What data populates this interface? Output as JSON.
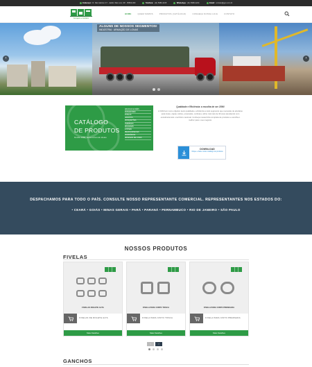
{
  "topbar": {
    "address_label": "Endereço:",
    "address": "R. São Gabriel, 47 - Jardim São Luís, SP - 05833-000",
    "phone_label": "Telefone:",
    "phone": "(11) 5980-4245",
    "whatsapp_label": "WhatsApp:",
    "whatsapp": "(11) 5980-4244",
    "email_label": "Email:",
    "email": "contato@jgm.com.br"
  },
  "brand": {
    "logo_text": "JGM",
    "tagline": "Ferragens e Artefatos"
  },
  "nav": {
    "items": [
      "HOME",
      "QUEM SOMOS",
      "PRODUTOS (CATÁLOGO)",
      "CONHEÇA NOSSA LOJA",
      "CONTATO"
    ]
  },
  "hero": {
    "caption_title": "ALGUNS DE NOSSOS SEGMENTOS!",
    "caption_sub": "INDÚSTRIA · ARMAÇÃO DE LONAS",
    "prev": "‹",
    "next": "›"
  },
  "catalog": {
    "title_line1": "CATÁLOGO",
    "title_line2": "DE PRODUTOS",
    "since": "Desde 1986, desenvolvendo ideias",
    "list": [
      "ARGOLAS E ANÉIS",
      "PASSADORES",
      "FIVELAS",
      "GANCHOS",
      "MOSQUETÕES",
      "TERMINAIS",
      "ROLDANAS",
      "ILHÓSES",
      "PEÇAS ESPECIAIS",
      "ACESSÓRIOS",
      "MATERIAIS DE LONAS"
    ]
  },
  "quality": {
    "title": "Qualidade e Eficiência: a escolha de ser JGM!",
    "paragraph": "A JGM tem como objetivo levar qualidade e eficiência a todo segmento que necessite de artefatos para lonas, capas, toldos, encerados, cortinas e afins. Há mais de 30 anos atendendo com excelência todo o território nacional. Conheça nossa linha completa de produtos e escolha o melhor para o seu negócio."
  },
  "download": {
    "title": "DOWNLOAD",
    "subtitle": "Clique e baixe nosso catálogo de produtos"
  },
  "band": {
    "line1": "DESPACHAMOS PARA TODO O PAÍS. CONSULTE NOSSO REPRESENTANTE COMERCIAL. REPRESENTANTES NOS ESTADOS DO:",
    "line2": "• CEARÁ • GOIÁS • MINAS GERAIS • PARÁ • PARANÁ • PERNAMBUCO • RIO DE JANEIRO • SÃO PAULO"
  },
  "products": {
    "section_title": "NOSSOS PRODUTOS",
    "category1": "FIVELAS",
    "category2": "GANCHOS",
    "cards": [
      {
        "name": "FIVELAS ROLETE ALTA",
        "name2": "FIVELAS DE ROLETE ALTA",
        "more": "Mais Detalhes"
      },
      {
        "name": "FIVELA PARA CINTO TOSCA",
        "name2": "FIVELA PARA CINTO TOSCA",
        "more": "Mais Detalhes"
      },
      {
        "name": "FIVELA PARA CINTO PRENSADA",
        "name2": "FIVELA PARA CINTO PRENSADA",
        "more": "Mais Detalhes"
      }
    ],
    "pager_prev": "‹",
    "pager_next": "›"
  },
  "colors": {
    "brand_green": "#2e9b46",
    "band_blue": "#344b5e",
    "topbar": "#2b2b2b",
    "download_blue": "#2a8fd8"
  }
}
